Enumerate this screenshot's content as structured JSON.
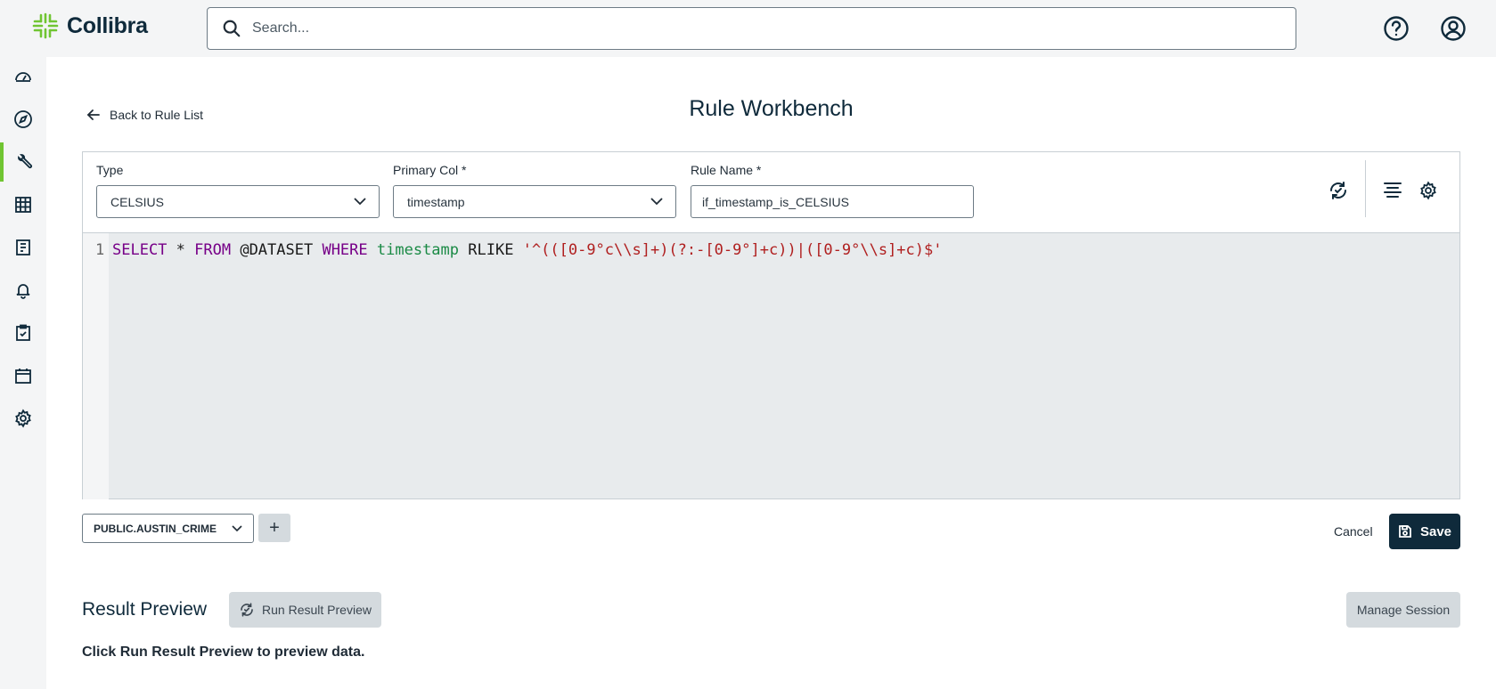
{
  "app": {
    "name": "Collibra",
    "brand_color": "#70c532"
  },
  "search": {
    "placeholder": "Search..."
  },
  "header": {
    "help_icon": "question-circle-icon",
    "user_icon": "user-circle-icon"
  },
  "sidebar": {
    "active_index": 2,
    "items": [
      {
        "icon": "dashboard-icon"
      },
      {
        "icon": "compass-icon"
      },
      {
        "icon": "rules-wrench-icon"
      },
      {
        "icon": "table-icon"
      },
      {
        "icon": "report-icon"
      },
      {
        "icon": "bell-icon"
      },
      {
        "icon": "clipboard-check-icon"
      },
      {
        "icon": "calendar-icon"
      },
      {
        "icon": "settings-gear-icon"
      }
    ]
  },
  "page": {
    "title": "Rule Workbench",
    "back_label": "Back to Rule List"
  },
  "form": {
    "type_label": "Type",
    "type_value": "CELSIUS",
    "primary_col_label": "Primary Col *",
    "primary_col_value": "timestamp",
    "rule_name_label": "Rule Name *",
    "rule_name_value": "if_timestamp_is_CELSIUS"
  },
  "editor": {
    "line_number": "1",
    "tokens": {
      "t1": "SELECT",
      "t2": " * ",
      "t3": "FROM",
      "t4": " @DATASET ",
      "t5": "WHERE",
      "t6": " ",
      "t7": "timestamp",
      "t8": " RLIKE ",
      "t9": "'^(([0-9°c\\\\s]+)(?:-[0-9°]+c))|([0-9°\\\\s]+c)$'"
    }
  },
  "footer": {
    "dataset_value": "PUBLIC.AUSTIN_CRIME",
    "add_label": "+",
    "cancel_label": "Cancel",
    "save_label": "Save"
  },
  "results": {
    "title": "Result Preview",
    "run_label": "Run Result Preview",
    "manage_label": "Manage Session",
    "hint": "Click Run Result Preview to preview data."
  }
}
